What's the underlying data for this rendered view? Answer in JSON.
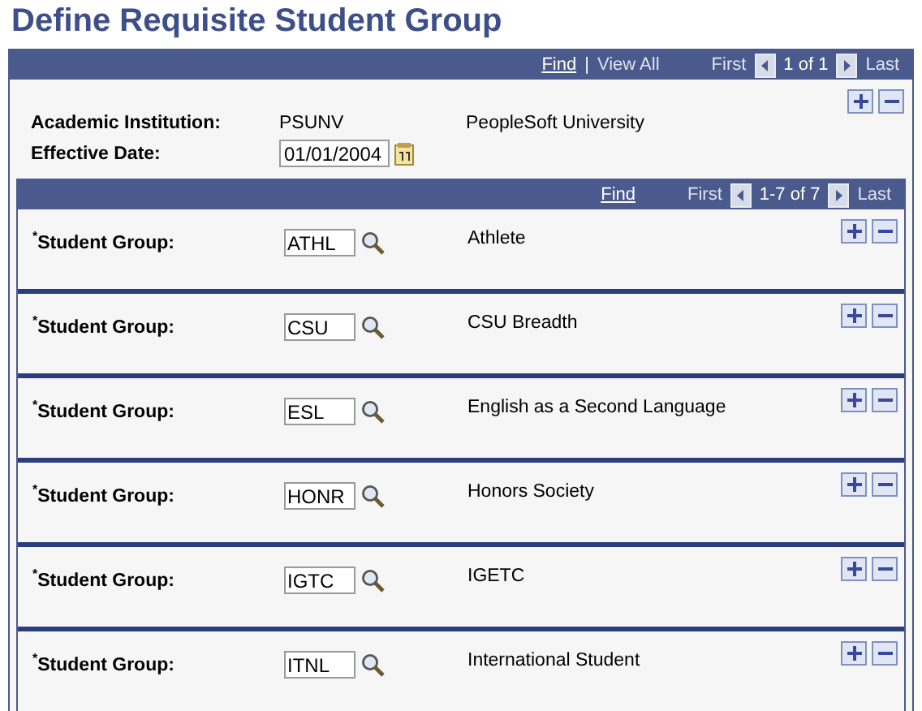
{
  "page_title": "Define Requisite Student Group",
  "outer_nav": {
    "find": "Find",
    "separator": "|",
    "view_all": "View All",
    "first": "First",
    "range": "1 of 1",
    "last": "Last"
  },
  "institution": {
    "label": "Academic Institution:",
    "code": "PSUNV",
    "name": "PeopleSoft University"
  },
  "effective_date": {
    "label": "Effective Date:",
    "value": "01/01/2004"
  },
  "inner_nav": {
    "find": "Find",
    "first": "First",
    "range": "1-7 of 7",
    "last": "Last"
  },
  "rows": [
    {
      "label": "$^{*}$Student Group:",
      "value": "ATHL",
      "description": "Athlete"
    },
    {
      "label": "$^{*}$Student Group:",
      "value": "CSU",
      "description": "CSU Breadth"
    },
    {
      "label": "$^{*}$Student Group:",
      "value": "ESL",
      "description": "English as a Second Language"
    },
    {
      "label": "$^{*}$Student Group:",
      "value": "HONR",
      "description": "Honors Society"
    },
    {
      "label": "$^{*}$Student Group:",
      "value": "IGTC",
      "description": "IGETC"
    },
    {
      "label": "$^{*}$Student Group:",
      "value": "ITNL",
      "description": "International Student"
    }
  ]
}
